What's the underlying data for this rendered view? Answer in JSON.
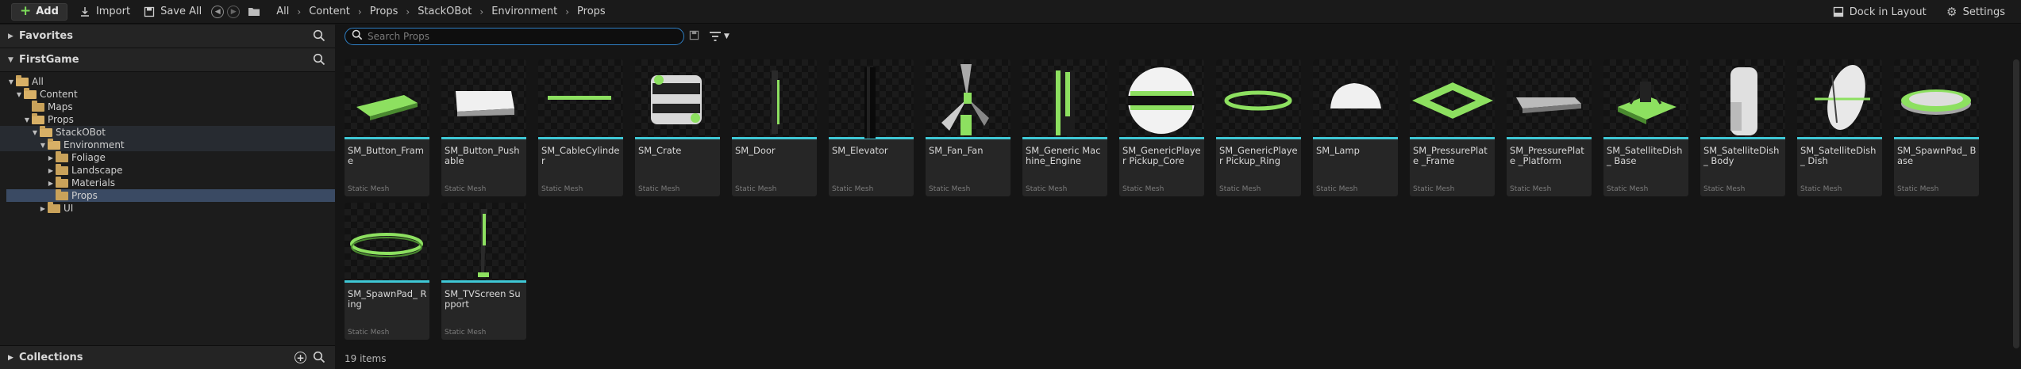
{
  "toolbar": {
    "add_label": "Add",
    "import_label": "Import",
    "save_all_label": "Save All",
    "breadcrumbs": [
      "All",
      "Content",
      "Props",
      "StackOBot",
      "Environment",
      "Props"
    ],
    "dock_label": "Dock in Layout",
    "settings_label": "Settings"
  },
  "left": {
    "favorites_label": "Favorites",
    "project_label": "FirstGame",
    "tree": [
      {
        "label": "All",
        "depth": 0,
        "expanded": true
      },
      {
        "label": "Content",
        "depth": 1,
        "expanded": true
      },
      {
        "label": "Maps",
        "depth": 2,
        "expanded": false
      },
      {
        "label": "Props",
        "depth": 2,
        "expanded": true
      },
      {
        "label": "StackOBot",
        "depth": 3,
        "expanded": true
      },
      {
        "label": "Environment",
        "depth": 4,
        "expanded": true
      },
      {
        "label": "Foliage",
        "depth": 5,
        "expanded": false
      },
      {
        "label": "Landscape",
        "depth": 5,
        "expanded": false
      },
      {
        "label": "Materials",
        "depth": 5,
        "expanded": false
      },
      {
        "label": "Props",
        "depth": 5,
        "expanded": false,
        "selected": true
      },
      {
        "label": "UI",
        "depth": 4,
        "expanded": false
      }
    ],
    "collections_label": "Collections"
  },
  "search": {
    "placeholder": "Search Props"
  },
  "assets": [
    {
      "name": "SM_Button_Frame",
      "type": "Static Mesh",
      "shape": "frame"
    },
    {
      "name": "SM_Button_Pushable",
      "type": "Static Mesh",
      "shape": "block"
    },
    {
      "name": "SM_CableCylinder",
      "type": "Static Mesh",
      "shape": "cable"
    },
    {
      "name": "SM_Crate",
      "type": "Static Mesh",
      "shape": "crate"
    },
    {
      "name": "SM_Door",
      "type": "Static Mesh",
      "shape": "door"
    },
    {
      "name": "SM_Elevator",
      "type": "Static Mesh",
      "shape": "elevator"
    },
    {
      "name": "SM_Fan_Fan",
      "type": "Static Mesh",
      "shape": "fan"
    },
    {
      "name": "SM_Generic Machine_Engine",
      "type": "Static Mesh",
      "shape": "engine"
    },
    {
      "name": "SM_GenericPlayer Pickup_Core",
      "type": "Static Mesh",
      "shape": "sphere"
    },
    {
      "name": "SM_GenericPlayer Pickup_Ring",
      "type": "Static Mesh",
      "shape": "ring"
    },
    {
      "name": "SM_Lamp",
      "type": "Static Mesh",
      "shape": "lamp"
    },
    {
      "name": "SM_PressurePlate _Frame",
      "type": "Static Mesh",
      "shape": "plateframe"
    },
    {
      "name": "SM_PressurePlate _Platform",
      "type": "Static Mesh",
      "shape": "platform"
    },
    {
      "name": "SM_SatelliteDish_ Base",
      "type": "Static Mesh",
      "shape": "dishbase"
    },
    {
      "name": "SM_SatelliteDish_ Body",
      "type": "Static Mesh",
      "shape": "dishbody"
    },
    {
      "name": "SM_SatelliteDish_ Dish",
      "type": "Static Mesh",
      "shape": "dish"
    },
    {
      "name": "SM_SpawnPad_ Base",
      "type": "Static Mesh",
      "shape": "pad"
    },
    {
      "name": "SM_SpawnPad_ Ring",
      "type": "Static Mesh",
      "shape": "padring"
    },
    {
      "name": "SM_TVScreen Support",
      "type": "Static Mesh",
      "shape": "tvsupport"
    }
  ],
  "status": {
    "item_count": "19 items"
  },
  "colors": {
    "accent_green": "#7ddc5a",
    "tile_underline": "#3fc8d6",
    "selection": "#3a4a63",
    "search_border": "#2f7fc4"
  }
}
